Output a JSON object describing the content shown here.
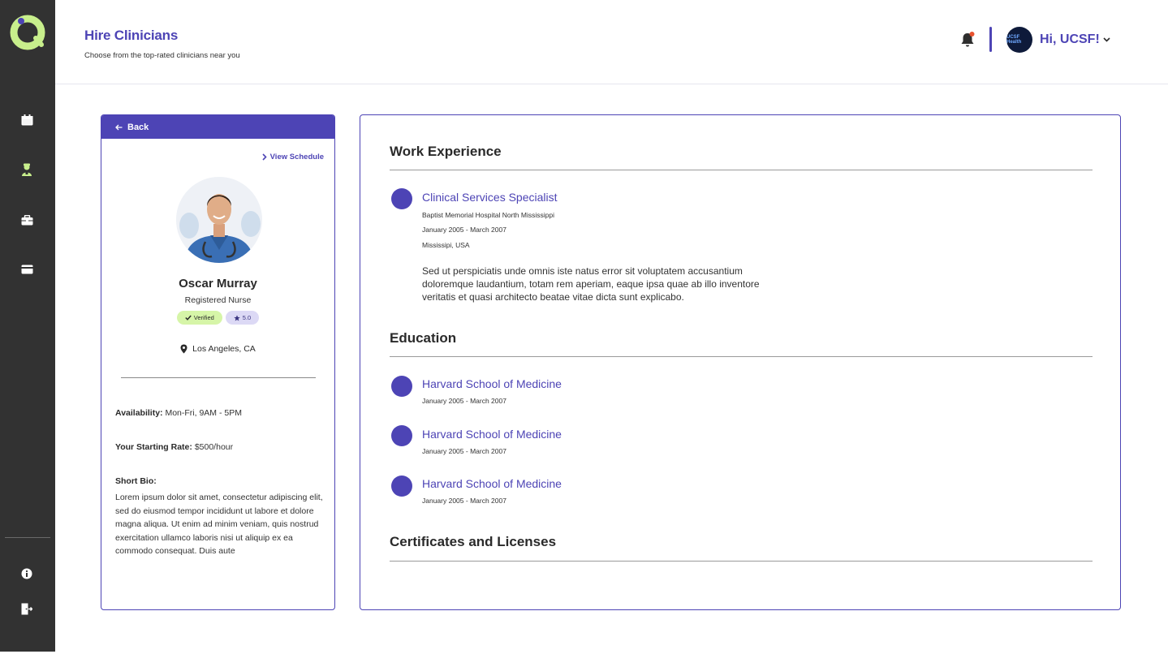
{
  "header": {
    "title": "Hire Clinicians",
    "subtitle": "Choose from the top-rated clinicians near you",
    "greeting": "Hi, UCSF!",
    "avatar_text": "UCSF Health"
  },
  "sidebar": {
    "items": [
      {
        "icon": "calendar-icon"
      },
      {
        "icon": "clinician-icon"
      },
      {
        "icon": "briefcase-icon"
      },
      {
        "icon": "credit-card-icon"
      }
    ],
    "bottom_items": [
      {
        "icon": "info-icon"
      },
      {
        "icon": "logout-icon"
      }
    ]
  },
  "profile": {
    "back_label": "Back",
    "view_schedule_label": "View Schedule",
    "name": "Oscar Murray",
    "role": "Registered Nurse",
    "verified_label": "Verified",
    "rating": "5.0",
    "location": "Los Angeles, CA",
    "availability_label": "Availability:",
    "availability_value": "Mon-Fri, 9AM - 5PM",
    "rate_label": "Your Starting Rate:",
    "rate_value": "$500/hour",
    "bio_label": "Short Bio:",
    "bio_text": "Lorem ipsum dolor sit amet, consectetur adipiscing elit, sed do eiusmod tempor incididunt ut labore et dolore magna aliqua. Ut enim ad minim veniam, quis nostrud exercitation ullamco laboris nisi ut aliquip ex ea commodo consequat. Duis aute"
  },
  "work": {
    "title": "Work Experience",
    "items": [
      {
        "title": "Clinical Services Specialist",
        "org": "Baptist Memorial Hospital North Mississippi",
        "dates": "January 2005 - March 2007",
        "location": "Mississipi, USA",
        "description": "Sed ut perspiciatis unde omnis iste natus error sit voluptatem accusantium doloremque laudantium, totam rem aperiam, eaque ipsa quae ab illo inventore veritatis et quasi architecto beatae vitae dicta sunt explicabo."
      }
    ]
  },
  "education": {
    "title": "Education",
    "items": [
      {
        "title": "Harvard School of Medicine",
        "dates": "January 2005 - March 2007"
      },
      {
        "title": "Harvard School of Medicine",
        "dates": "January 2005 - March 2007"
      },
      {
        "title": "Harvard School of Medicine",
        "dates": "January 2005 - March 2007"
      }
    ]
  },
  "certificates": {
    "title": "Certificates and Licenses"
  },
  "colors": {
    "accent": "#4d44b5",
    "sidebar": "#323232",
    "logo_green": "#c8ef8c",
    "verified_bg": "#d6f5a8",
    "rating_bg": "#dcd9f5",
    "notification": "#e8522f"
  }
}
